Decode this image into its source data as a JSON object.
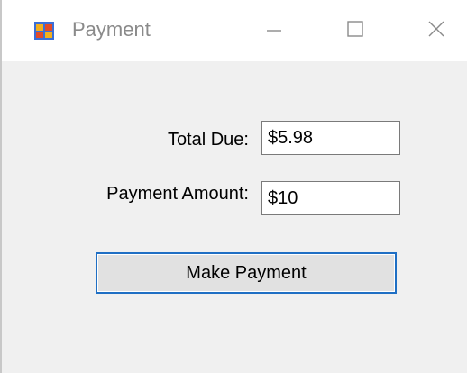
{
  "window": {
    "title": "Payment",
    "icon": "windows-form-icon"
  },
  "controls": {
    "minimize_icon": "minimize-icon",
    "maximize_icon": "maximize-icon",
    "close_icon": "close-icon"
  },
  "form": {
    "total_due_label": "Total Due:",
    "total_due_value": "$5.98",
    "payment_amount_label": "Payment Amount:",
    "payment_amount_value": "$10",
    "make_payment_label": "Make Payment"
  },
  "colors": {
    "accent_border": "#1f6fc4",
    "window_bg": "#f0f0f0"
  }
}
